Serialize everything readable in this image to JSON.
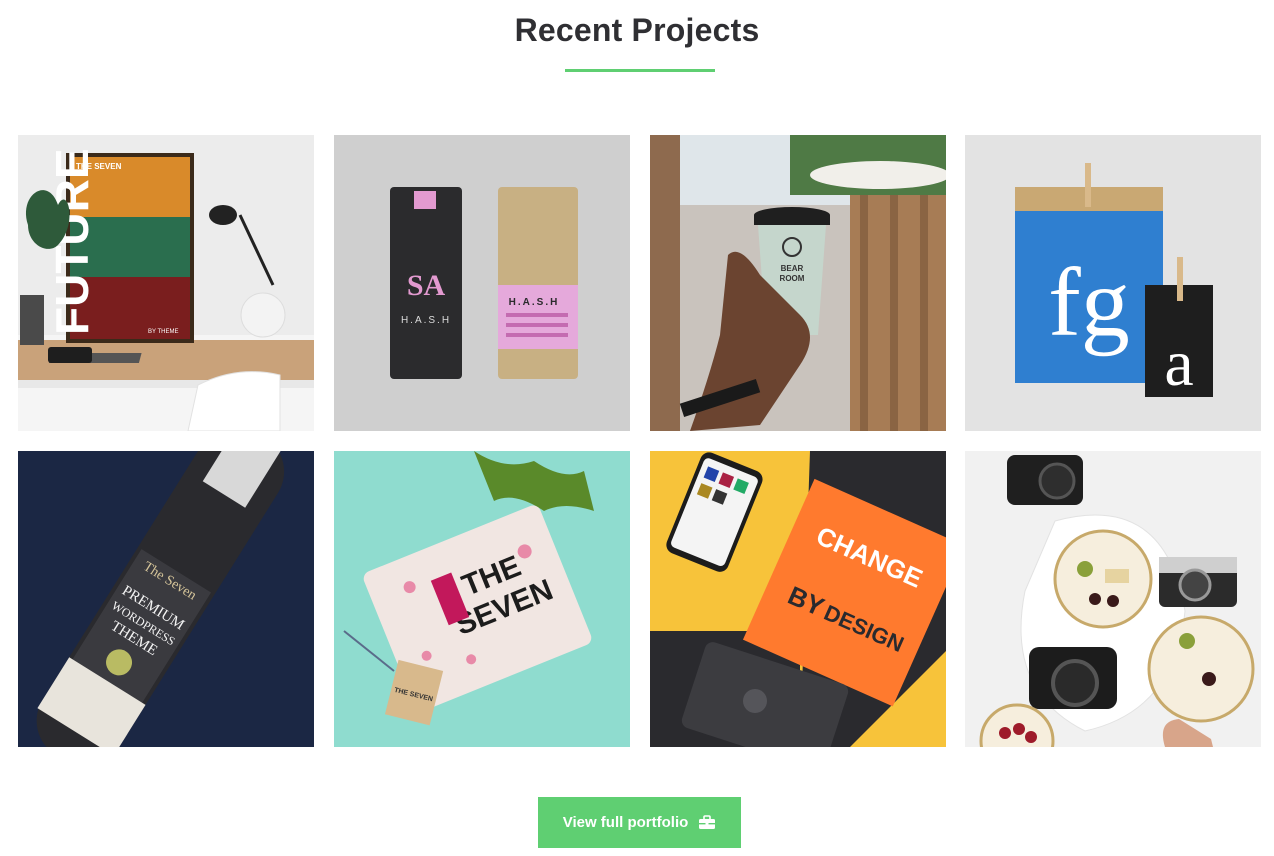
{
  "section": {
    "title": "Recent Projects",
    "accent_color": "#5fcf72"
  },
  "projects": [
    {
      "name": "future-poster",
      "text": {
        "brand": "THE SEVEN",
        "word": "FUTURE",
        "byline": "BY THEME"
      }
    },
    {
      "name": "hash-coffee-bags",
      "text": {
        "brand": "H.A.S.H",
        "brand2": "H.A.S.H"
      }
    },
    {
      "name": "bear-room-coffee-cup",
      "text": {
        "line1": "BEAR",
        "line2": "ROOM"
      }
    },
    {
      "name": "fga-paper-bag",
      "text": {
        "big": "fg",
        "small": "a"
      }
    },
    {
      "name": "premium-wine-bottle",
      "text": {
        "brand": "The Seven",
        "line1": "PREMIUM",
        "line2": "WORDPRESS",
        "line3": "THEME"
      }
    },
    {
      "name": "the-seven-tshirt",
      "text": {
        "line1": "THE",
        "line2": "SEVEN",
        "tag": "THE SEVEN"
      }
    },
    {
      "name": "change-by-design-book",
      "text": {
        "line1": "CHANGE",
        "line2": "BY",
        "line3": "DESIGN"
      }
    },
    {
      "name": "cameras-food-flatlay",
      "text": {}
    }
  ],
  "cta": {
    "label": "View full portfolio",
    "icon": "briefcase-icon"
  }
}
